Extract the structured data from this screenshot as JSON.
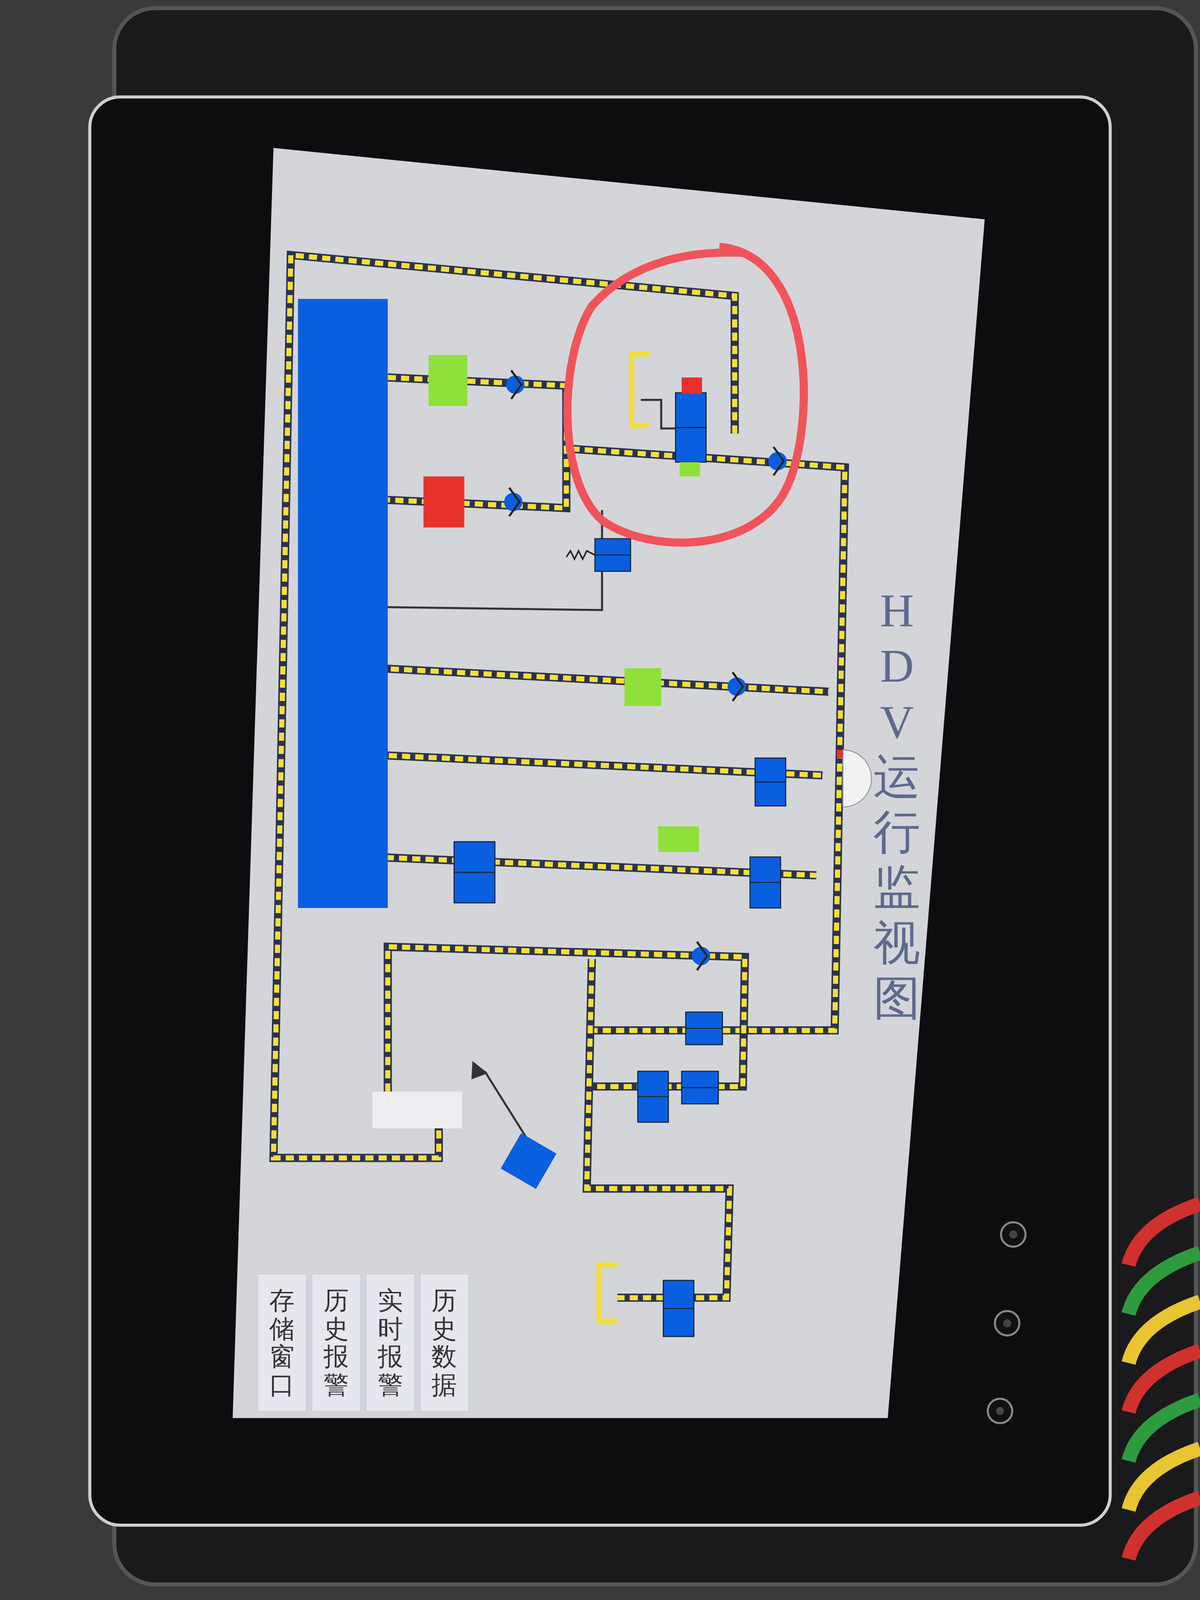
{
  "title": "HDV运行监视图",
  "buttons": [
    "历史数据",
    "实时报警",
    "历史报警",
    "存储窗口"
  ],
  "indicators": [
    {
      "color": "#8fe03a"
    },
    {
      "color": "#e8302a"
    },
    {
      "color": "#8fe03a"
    },
    {
      "color": "#8fe03a"
    }
  ]
}
